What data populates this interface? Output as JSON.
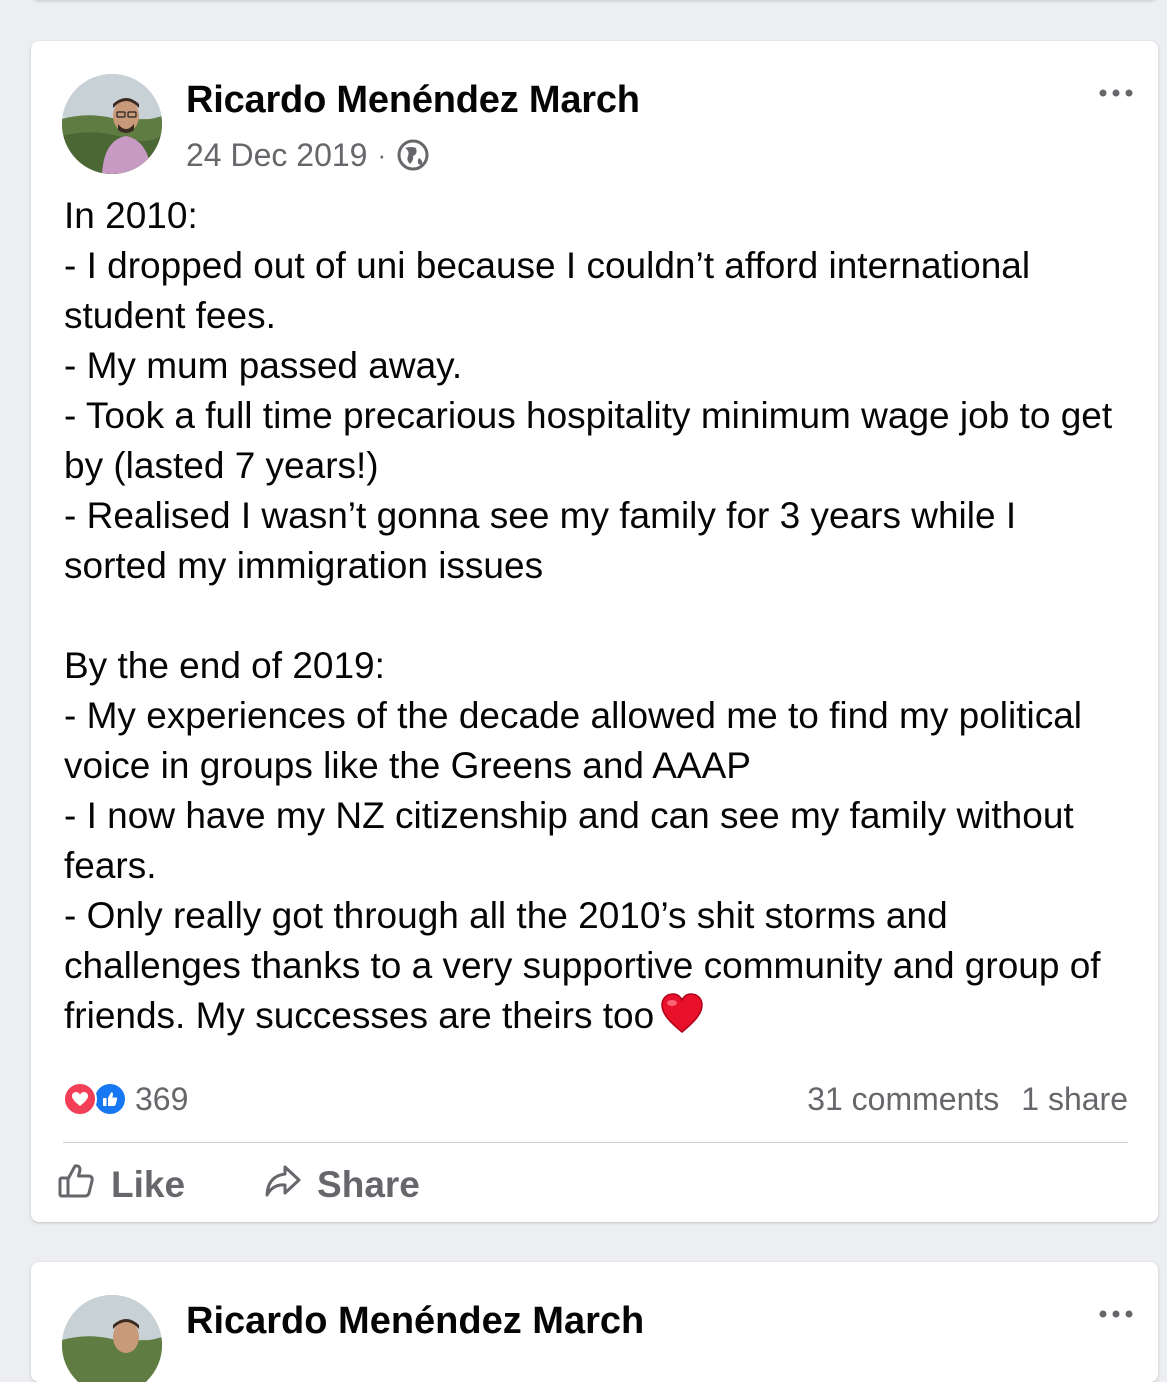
{
  "post": {
    "author": "Ricardo Menéndez March",
    "date": "24 Dec 2019",
    "separator": "·",
    "visibility_icon": "globe-icon",
    "body": "In 2010:\n- I dropped out of uni because I couldn’t afford international student fees.\n- My mum passed away.\n- Took a full time precarious hospitality minimum wage job to get by (lasted 7 years!)\n- Realised I wasn’t gonna see my family for 3 years while I sorted my immigration issues\n\nBy the end of 2019:\n- My experiences of the decade allowed me to find my political voice in groups like the Greens and AAAP\n- I now have my NZ citizenship and can see my family without fears.\n- Only really got through all the 2010’s shit storms and challenges thanks to a very supportive community and group of friends. My successes are theirs too",
    "body_emoji_icon": "red-heart-emoji-icon",
    "reaction_count": "369",
    "comments_text": "31 comments",
    "shares_text": "1 share",
    "like_label": "Like",
    "share_label": "Share"
  },
  "next_post": {
    "author": "Ricardo Menéndez March"
  },
  "colors": {
    "background": "#eceef2",
    "card": "#ffffff",
    "secondary_text": "#65676b",
    "like_blue": "#1877f2",
    "love_red": "#f33e58"
  }
}
